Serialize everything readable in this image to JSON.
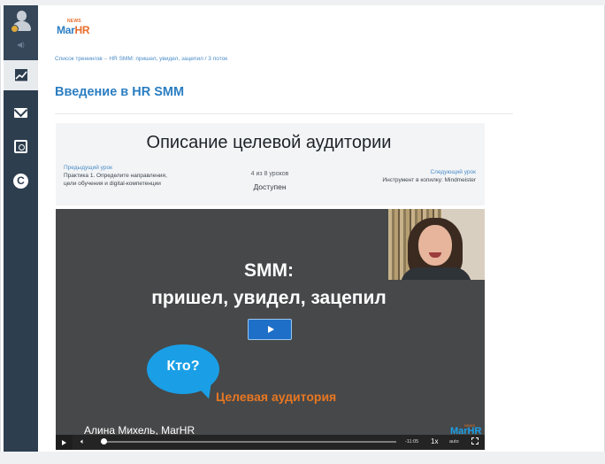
{
  "logo": {
    "top_text": "NEWS",
    "main_text_a": "Mar",
    "main_text_b": "HR"
  },
  "sidebar": {
    "mute_label": "◀)",
    "items": [
      {
        "icon": "chart-icon",
        "active": true
      },
      {
        "icon": "mail-icon",
        "active": false
      },
      {
        "icon": "safe-icon",
        "active": false
      },
      {
        "icon": "c-logo-icon",
        "label": "C",
        "active": false
      }
    ]
  },
  "breadcrumb": {
    "items": [
      "Список тренингов",
      "HR SMM: пришел, увидел, зацепил / 3 поток"
    ],
    "separator": "–"
  },
  "page": {
    "title": "Введение в HR SMM"
  },
  "lesson": {
    "title": "Описание целевой аудитории",
    "prev": {
      "label": "Предыдущий урок",
      "text": "Практика 1. Определите направления, цели обучения и digital-компетенции"
    },
    "progress": "4 из 8 уроков",
    "status": "Доступен",
    "next": {
      "label": "Следующий урок",
      "text": "Инструмент в копилку: Mindmeister"
    }
  },
  "video": {
    "title_line1": "SMM:",
    "title_line2": "пришел, увидел, зацепил",
    "bubble_text": "Кто?",
    "audience_text": "Целевая аудитория",
    "presenter": "Алина Михель, MarHR",
    "watermark_top": "NEWS",
    "watermark_main": "MarHR",
    "controls": {
      "time": "-11:05",
      "speed": "1x",
      "quality": "auto",
      "progress_fraction": 0.01
    },
    "colors": {
      "play_button": "#1e6fc7",
      "bubble": "#1a9fe6",
      "audience_text": "#e87722"
    }
  },
  "colors": {
    "accent": "#2b7ec2",
    "sidebar": "#2d3e4f"
  }
}
